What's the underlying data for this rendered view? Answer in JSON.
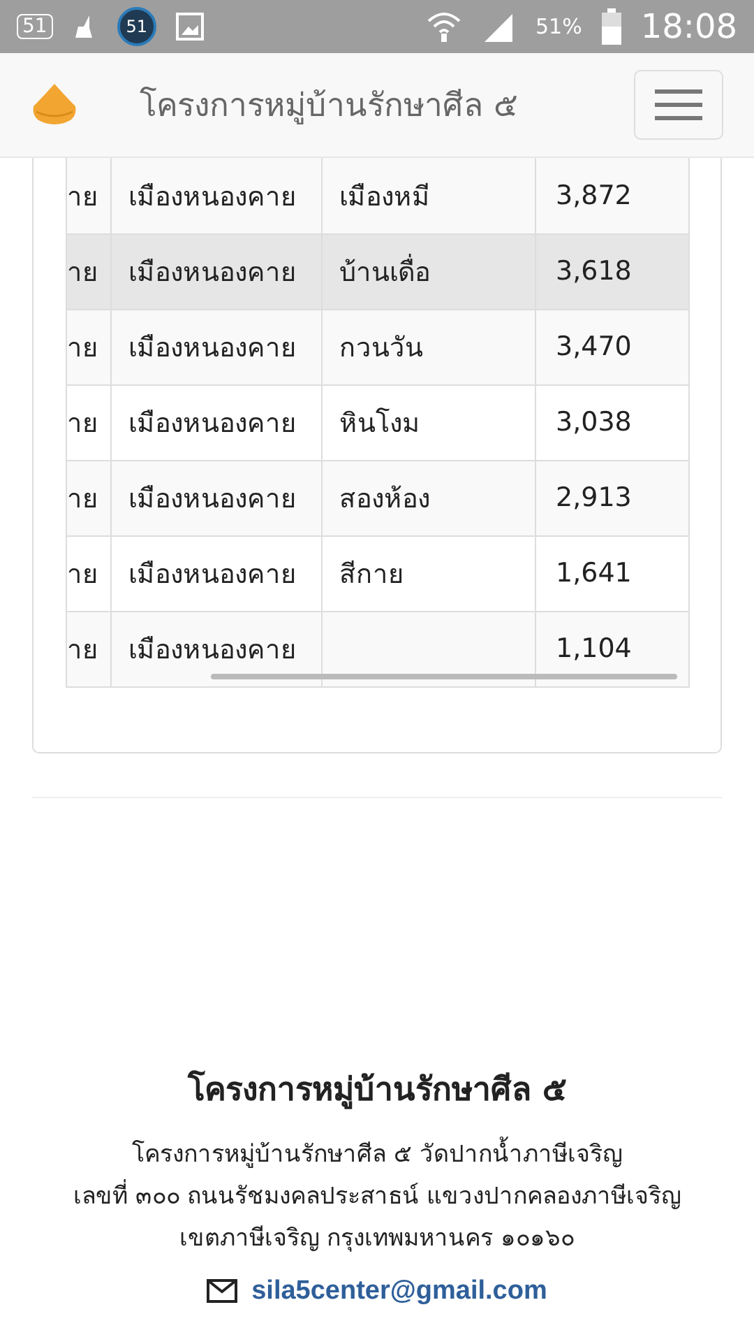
{
  "status_bar": {
    "notification_count": "51",
    "badge_count": "51",
    "battery": "51%",
    "time": "18:08"
  },
  "header": {
    "title": "โครงการหมู่บ้านรักษาศีล ๕"
  },
  "table": {
    "rows": [
      {
        "cells": [
          "าย",
          "เมืองหนองคาย",
          "เมืองหมี",
          "3,872"
        ],
        "highlighted": false
      },
      {
        "cells": [
          "าย",
          "เมืองหนองคาย",
          "บ้านเดื่อ",
          "3,618"
        ],
        "highlighted": true
      },
      {
        "cells": [
          "าย",
          "เมืองหนองคาย",
          "กวนวัน",
          "3,470"
        ],
        "highlighted": false
      },
      {
        "cells": [
          "าย",
          "เมืองหนองคาย",
          "หินโงม",
          "3,038"
        ],
        "highlighted": false
      },
      {
        "cells": [
          "าย",
          "เมืองหนองคาย",
          "สองห้อง",
          "2,913"
        ],
        "highlighted": false
      },
      {
        "cells": [
          "าย",
          "เมืองหนองคาย",
          "สีกาย",
          "1,641"
        ],
        "highlighted": false
      },
      {
        "cells": [
          "าย",
          "เมืองหนองคาย",
          "",
          "1,104"
        ],
        "highlighted": false
      }
    ]
  },
  "footer": {
    "title": "โครงการหมู่บ้านรักษาศีล ๕",
    "address_lines": [
      "โครงการหมู่บ้านรักษาศีล ๕ วัดปากน้ำภาษีเจริญ",
      "เลขที่ ๓๐๐ ถนนรัชมงคลประสาธน์ แขวงปากคลองภาษีเจริญ",
      "เขตภาษีเจริญ กรุงเทพมหานคร ๑๐๑๖๐"
    ],
    "email": "sila5center@gmail.com"
  }
}
